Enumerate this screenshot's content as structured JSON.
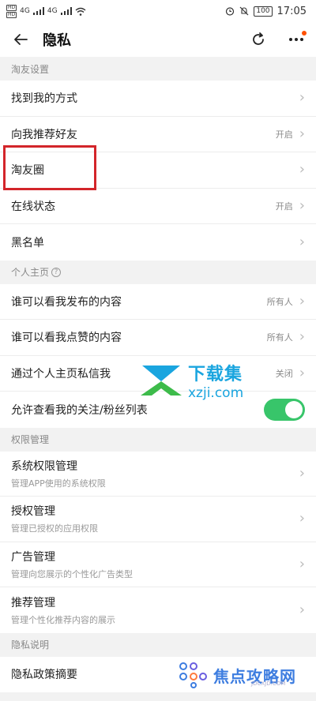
{
  "status_bar": {
    "hd1": "HD",
    "hd2": "HD",
    "signal1": "4G",
    "signal2": "4G",
    "battery": "100",
    "time": "17:05"
  },
  "nav": {
    "title": "隐私"
  },
  "sections": {
    "taoyou": {
      "header": "淘友设置",
      "rows": [
        {
          "label": "找到我的方式",
          "value": ""
        },
        {
          "label": "向我推荐好友",
          "value": "开启"
        },
        {
          "label": "淘友圈",
          "value": ""
        },
        {
          "label": "在线状态",
          "value": "开启"
        },
        {
          "label": "黑名单",
          "value": ""
        }
      ]
    },
    "profile": {
      "header": "个人主页",
      "rows": [
        {
          "label": "谁可以看我发布的内容",
          "value": "所有人"
        },
        {
          "label": "谁可以看我点赞的内容",
          "value": "所有人"
        },
        {
          "label": "通过个人主页私信我",
          "value": "关闭"
        },
        {
          "label": "允许查看我的关注/粉丝列表",
          "toggle_on": true
        }
      ]
    },
    "permissions": {
      "header": "权限管理",
      "rows": [
        {
          "label": "系统权限管理",
          "sub": "管理APP使用的系统权限"
        },
        {
          "label": "授权管理",
          "sub": "管理已授权的应用权限"
        },
        {
          "label": "广告管理",
          "sub": "管理向您展示的个性化广告类型"
        },
        {
          "label": "推荐管理",
          "sub": "管理个性化推荐内容的展示"
        }
      ]
    },
    "policy": {
      "header": "隐私说明",
      "rows": [
        {
          "label": "隐私政策摘要"
        }
      ]
    }
  },
  "watermarks": {
    "site1_name": "下载集",
    "site1_url": "xzji.com",
    "site2_name": "焦点攻略网",
    "site2_url": "JDCXJD.COM"
  },
  "colors": {
    "accent_orange": "#ff5000",
    "toggle_green": "#38c56a",
    "highlight_red": "#d3252a"
  }
}
